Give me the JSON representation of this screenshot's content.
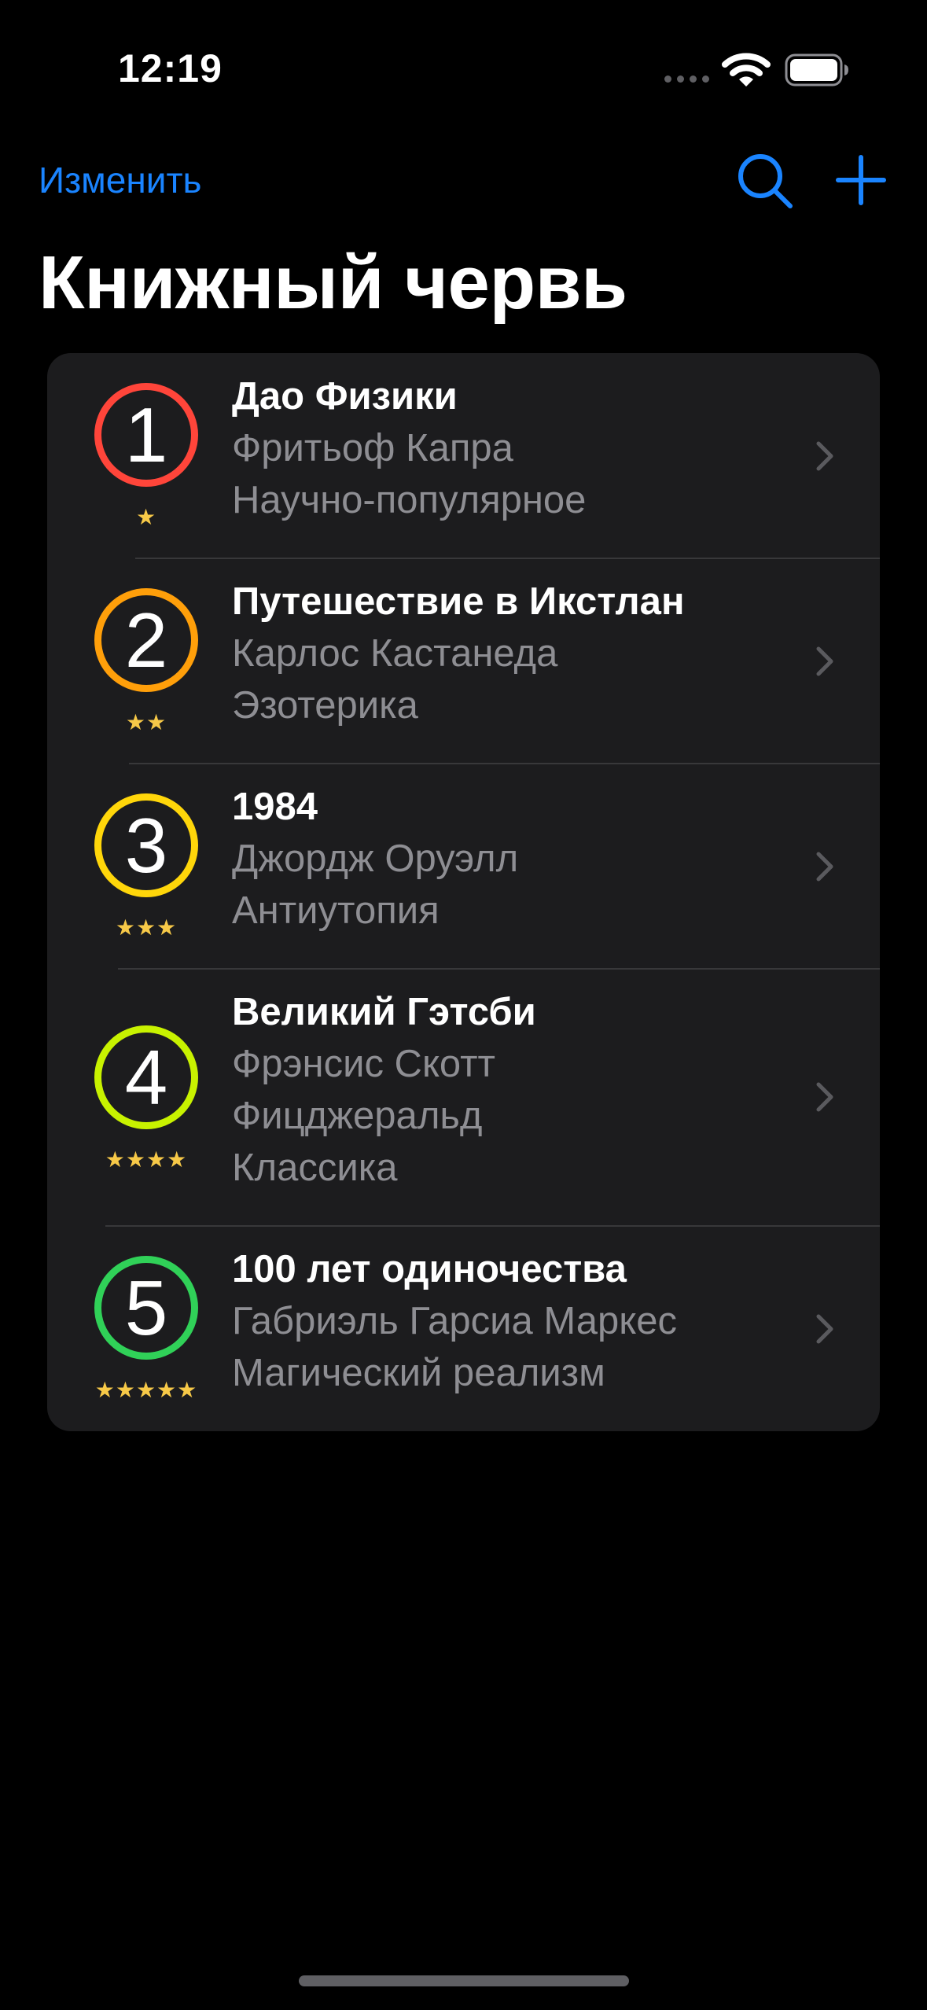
{
  "status_bar": {
    "time": "12:19"
  },
  "nav": {
    "edit_label": "Изменить"
  },
  "page": {
    "title": "Книжный червь"
  },
  "colors": {
    "accent": "#1a84ff",
    "secondary_text": "#8e8e93",
    "card": "#1c1c1e"
  },
  "books": [
    {
      "rank": "1",
      "title": "Дао Физики",
      "author": "Фритьоф Капра",
      "genre": "Научно-популярное",
      "stars": "★",
      "rating": 1,
      "badge_color": "#ff453a"
    },
    {
      "rank": "2",
      "title": "Путешествие в Икстлан",
      "author": "Карлос Кастанеда",
      "genre": "Эзотерика",
      "stars": "★★",
      "rating": 2,
      "badge_color": "#ff9f0a"
    },
    {
      "rank": "3",
      "title": "1984",
      "author": "Джордж Оруэлл",
      "genre": "Антиутопия",
      "stars": "★★★",
      "rating": 3,
      "badge_color": "#ffd60a"
    },
    {
      "rank": "4",
      "title": "Великий Гэтсби",
      "author": "Фрэнсис Скотт Фицджеральд",
      "genre": "Классика",
      "stars": "★★★★",
      "rating": 4,
      "badge_color": "#c8f200"
    },
    {
      "rank": "5",
      "title": "100 лет одиночества",
      "author": "Габриэль Гарсиа Маркес",
      "genre": "Магический реализм",
      "stars": "★★★★★",
      "rating": 5,
      "badge_color": "#30d158"
    }
  ]
}
